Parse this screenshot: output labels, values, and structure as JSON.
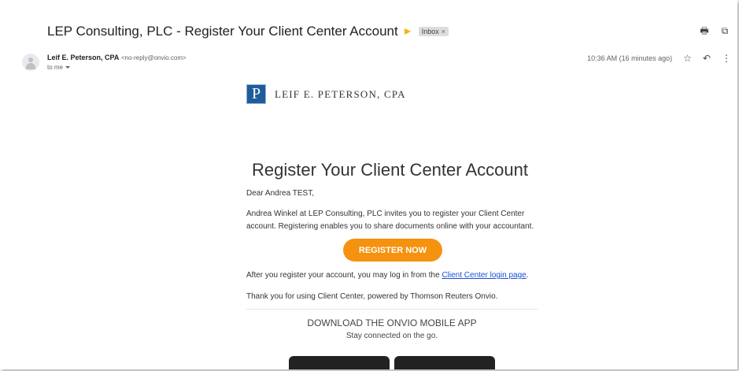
{
  "email": {
    "subject": "LEP Consulting, PLC - Register Your Client Center Account",
    "label": "Inbox",
    "label_close": "×",
    "sender_name": "Leif E. Peterson, CPA",
    "sender_email": "<no-reply@onvio.com>",
    "to": "to me",
    "time": "10:36 AM (16 minutes ago)"
  },
  "icons": {
    "print": "🖶",
    "open_new": "⧉",
    "star": "☆",
    "reply": "↶",
    "more": "⋮"
  },
  "body": {
    "logo_letter": "P",
    "logo_text": "LEIF E. PETERSON, CPA",
    "heading": "Register Your Client Center Account",
    "greeting": "Dear Andrea TEST,",
    "invite": "Andrea Winkel at LEP Consulting, PLC invites you to register your Client Center account. Registering enables you to share documents online with your accountant.",
    "button": "REGISTER NOW",
    "after_prefix": "After you register your account, you may log in from the ",
    "after_link": "Client Center login page",
    "after_suffix": ".",
    "thanks": "Thank you for using Client Center, powered by Thomson Reuters Onvio.",
    "download_title": "DOWNLOAD THE ONVIO MOBILE APP",
    "download_sub": "Stay connected on the go."
  },
  "colors": {
    "accent_orange": "#f5920f",
    "logo_blue": "#1f5c99",
    "link": "#1a4fd6"
  }
}
